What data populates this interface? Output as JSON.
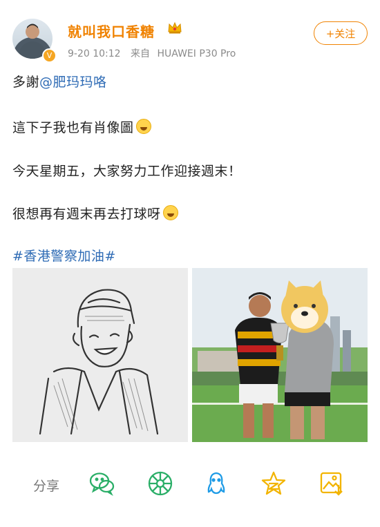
{
  "header": {
    "username": "就叫我口香糖",
    "timestamp": "9-20 10:12",
    "source_prefix": "来自",
    "device": "HUAWEI P30 Pro",
    "follow_label": "+关注"
  },
  "post": {
    "line1_prefix": "多謝",
    "line1_mention": "@肥玛玛咯",
    "line2": "這下子我也有肖像圖",
    "line3": "今天星期五，大家努力工作迎接週末！",
    "line4": "很想再有週末再去打球呀",
    "hashtag": "#香港警察加油#"
  },
  "actions": {
    "share_label": "分享",
    "icons": [
      "wechat-icon",
      "moments-icon",
      "qq-icon",
      "qzone-star-icon",
      "save-image-icon"
    ]
  },
  "colors": {
    "accent": "#f08200",
    "link": "#2e6bb5",
    "wechat": "#2aae67",
    "qq": "#1e9be6",
    "qzone": "#f2b400"
  }
}
